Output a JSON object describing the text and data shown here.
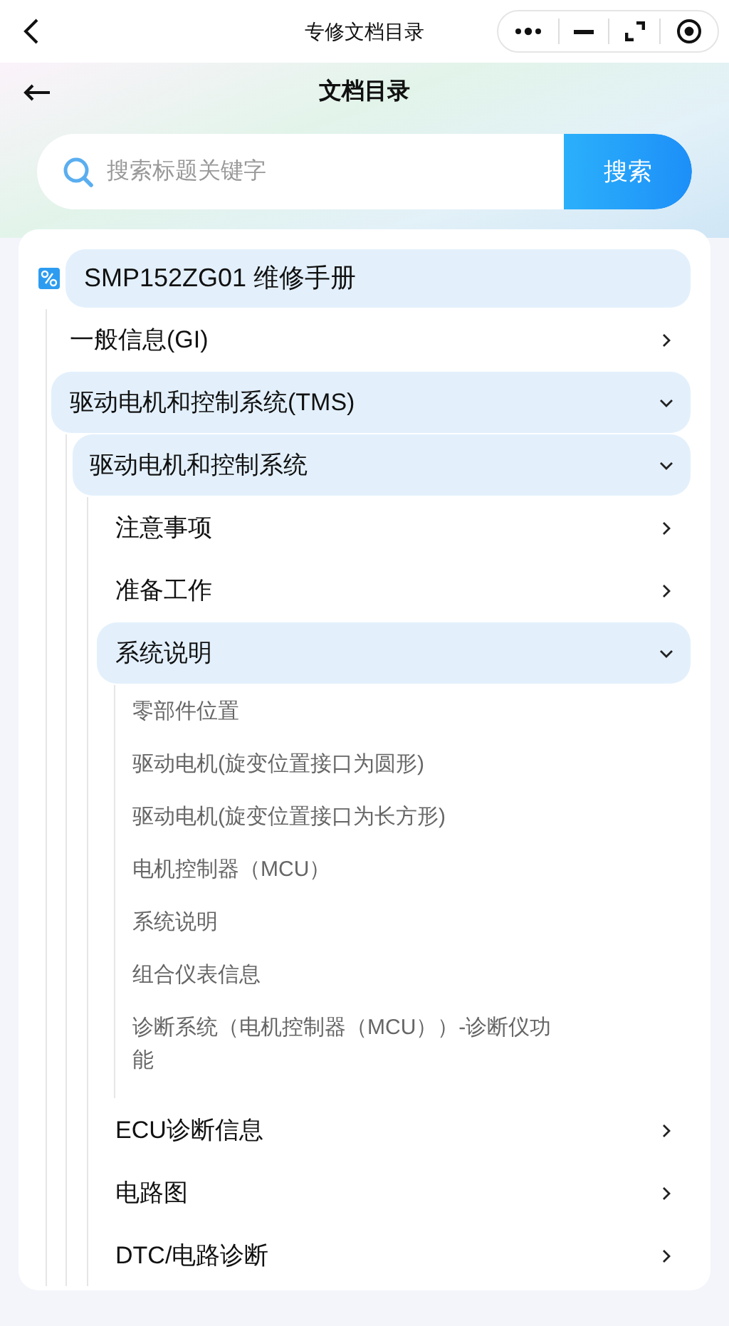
{
  "top_bar": {
    "title": "专修文档目录"
  },
  "header": {
    "title": "文档目录"
  },
  "search": {
    "placeholder": "搜索标题关键字",
    "button": "搜索"
  },
  "tree": {
    "label": "SMP152ZG01 维修手册",
    "children": [
      {
        "kind": "branch",
        "label": "一般信息(GI)",
        "expanded": false
      },
      {
        "kind": "branch",
        "label": "驱动电机和控制系统(TMS)",
        "expanded": true,
        "children": [
          {
            "kind": "branch",
            "label": "驱动电机和控制系统",
            "expanded": true,
            "children": [
              {
                "kind": "branch",
                "label": "注意事项",
                "expanded": false
              },
              {
                "kind": "branch",
                "label": "准备工作",
                "expanded": false
              },
              {
                "kind": "branch",
                "label": "系统说明",
                "expanded": true,
                "children": [
                  {
                    "kind": "leaf",
                    "label": "零部件位置"
                  },
                  {
                    "kind": "leaf",
                    "label": "驱动电机(旋变位置接口为圆形)"
                  },
                  {
                    "kind": "leaf",
                    "label": "驱动电机(旋变位置接口为长方形)"
                  },
                  {
                    "kind": "leaf",
                    "label": "电机控制器（MCU）"
                  },
                  {
                    "kind": "leaf",
                    "label": "系统说明"
                  },
                  {
                    "kind": "leaf",
                    "label": "组合仪表信息"
                  },
                  {
                    "kind": "leaf",
                    "label": "诊断系统（电机控制器（MCU））-诊断仪功能"
                  }
                ]
              },
              {
                "kind": "branch",
                "label": "ECU诊断信息",
                "expanded": false
              },
              {
                "kind": "branch",
                "label": "电路图",
                "expanded": false
              },
              {
                "kind": "branch",
                "label": "DTC/电路诊断",
                "expanded": false
              }
            ]
          }
        ]
      }
    ]
  }
}
